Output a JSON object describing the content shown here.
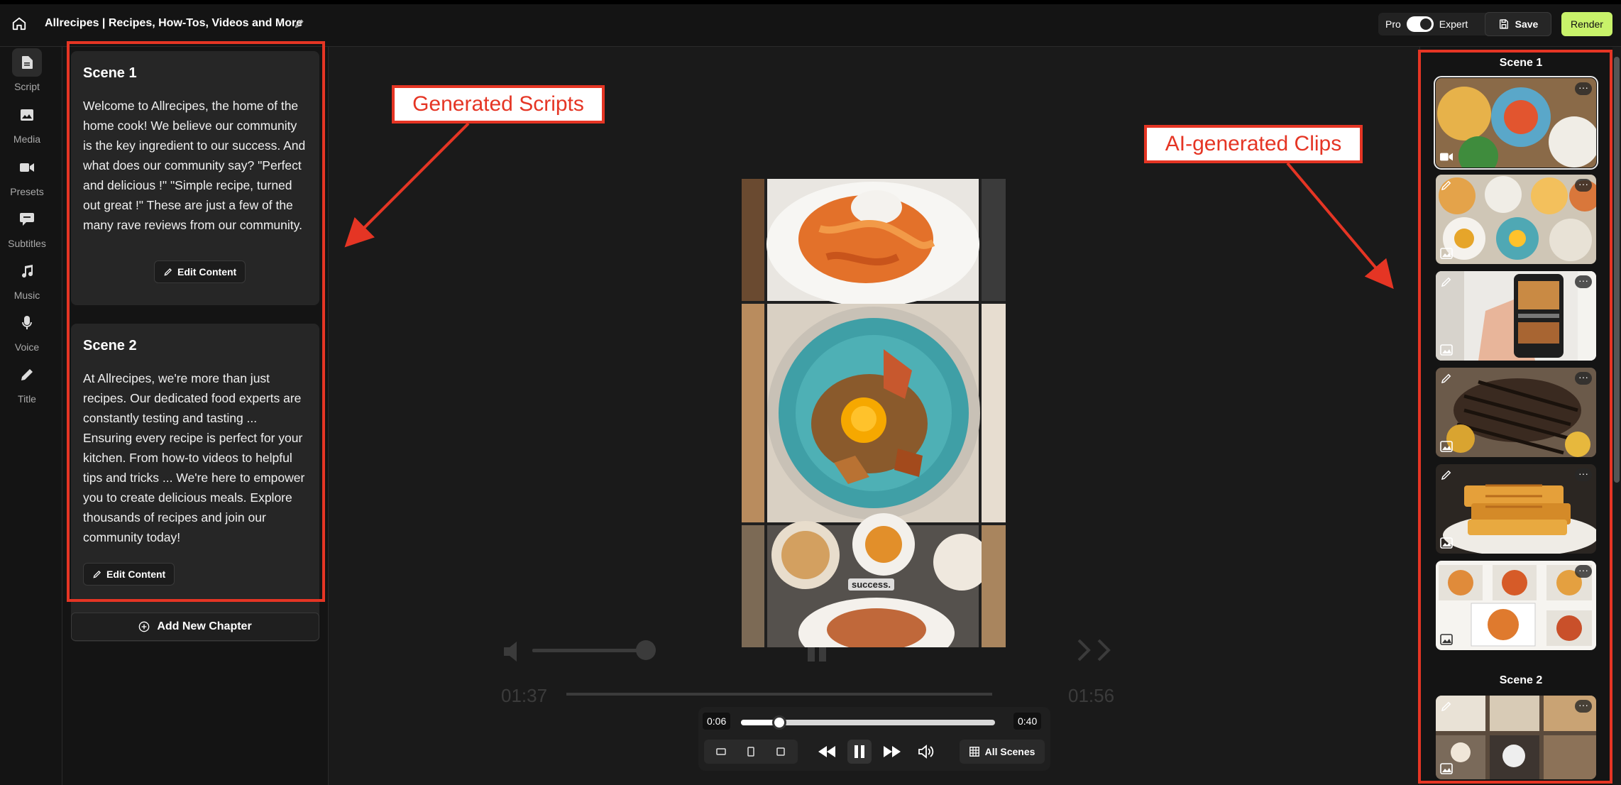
{
  "header": {
    "title": "Allrecipes | Recipes, How-Tos, Videos and More",
    "mode_left": "Pro",
    "mode_right": "Expert",
    "save_label": "Save",
    "render_label": "Render"
  },
  "nav": {
    "items": [
      {
        "label": "Script",
        "icon": "document-icon"
      },
      {
        "label": "Media",
        "icon": "image-icon"
      },
      {
        "label": "Presets",
        "icon": "video-camera-icon"
      },
      {
        "label": "Subtitles",
        "icon": "chat-bubble-icon"
      },
      {
        "label": "Music",
        "icon": "music-note-icon"
      },
      {
        "label": "Voice",
        "icon": "microphone-icon"
      },
      {
        "label": "Title",
        "icon": "pen-icon"
      }
    ]
  },
  "scenes": [
    {
      "title": "Scene 1",
      "text": "Welcome to Allrecipes, the home of the home cook! We believe our community is the key ingredient to our success. And what does our community say? \"Perfect and delicious !\" \"Simple recipe, turned out great !\" These are just a few of the many rave reviews from our community.",
      "edit_label": "Edit Content"
    },
    {
      "title": "Scene 2",
      "text": "At Allrecipes, we're more than just recipes. Our dedicated food experts are constantly testing and tasting ... Ensuring every recipe is perfect for your kitchen. From how-to videos to helpful tips and tricks ... We're here to empower you to create delicious meals. Explore thousands of recipes and join our community today!",
      "edit_label": "Edit Content"
    }
  ],
  "add_chapter_label": "Add New Chapter",
  "annotations": {
    "scripts_label": "Generated Scripts",
    "clips_label": "AI-generated Clips"
  },
  "preview": {
    "caption": "success."
  },
  "player": {
    "current_time": "0:06",
    "duration": "0:40",
    "progress": 0.15,
    "all_scenes_label": "All Scenes",
    "ghost_time_left": "01:37",
    "ghost_time_right": "01:56"
  },
  "clips": {
    "scene1_heading": "Scene 1",
    "scene2_heading": "Scene 2",
    "more_label": "···"
  },
  "colors": {
    "accent": "#c8f26a",
    "annotation": "#e53524",
    "panel": "#141414",
    "card": "#262626"
  }
}
